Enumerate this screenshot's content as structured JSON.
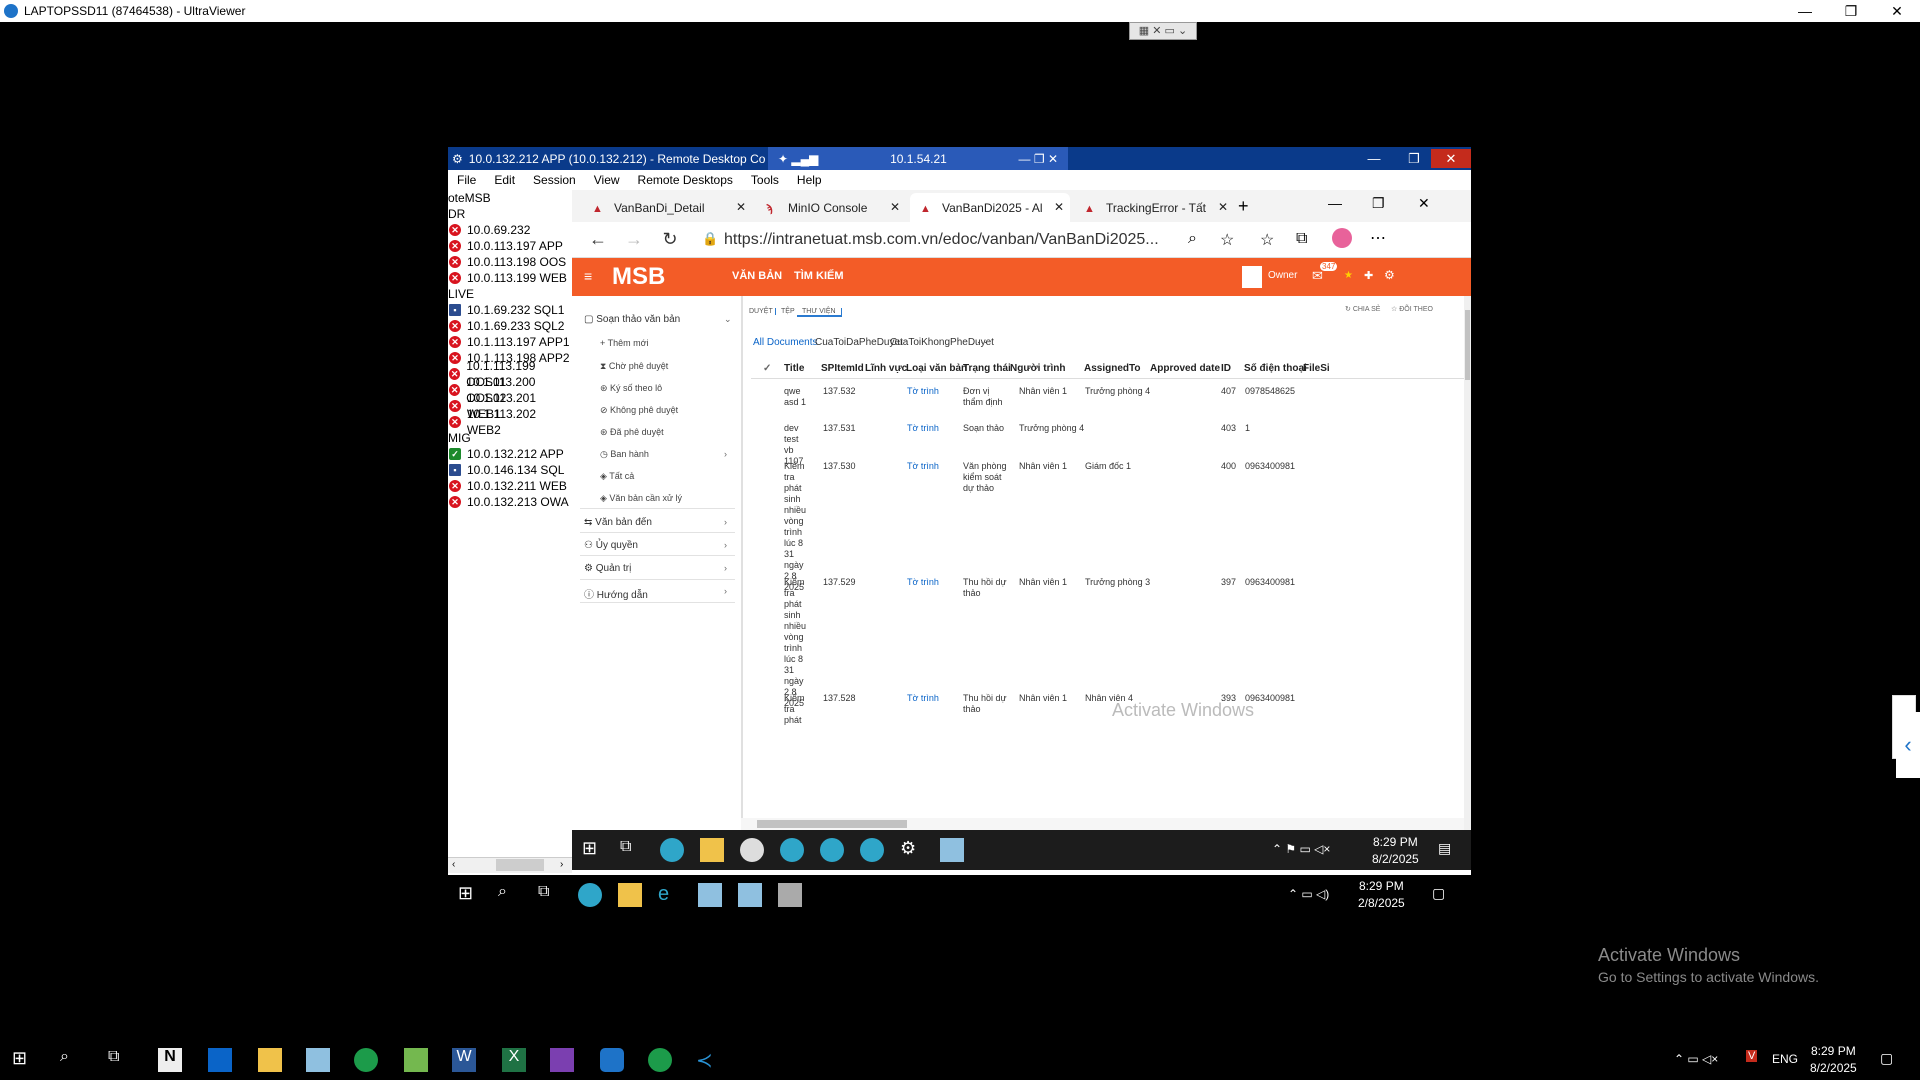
{
  "uv_title": "LAPTOPSSD11 (87464538) - UltraViewer",
  "uv_controls": {
    "minimize": "—",
    "restore": "❐",
    "close": "✕"
  },
  "rdc": {
    "title": "10.0.132.212 APP (10.0.132.212) - Remote Desktop Co",
    "conn_ip": "10.1.54.21",
    "menu": [
      "File",
      "Edit",
      "Session",
      "View",
      "Remote Desktops",
      "Tools",
      "Help"
    ],
    "tree": [
      {
        "type": "group",
        "label": "oteMSB"
      },
      {
        "type": "group",
        "label": "DR"
      },
      {
        "type": "item",
        "status": "err",
        "label": "10.0.69.232"
      },
      {
        "type": "item",
        "status": "err",
        "label": "10.0.113.197 APP"
      },
      {
        "type": "item",
        "status": "err",
        "label": "10.0.113.198 OOS"
      },
      {
        "type": "item",
        "status": "err",
        "label": "10.0.113.199 WEB"
      },
      {
        "type": "group",
        "label": "LIVE"
      },
      {
        "type": "item",
        "status": "pc",
        "label": "10.1.69.232 SQL1"
      },
      {
        "type": "item",
        "status": "err",
        "label": "10.1.69.233 SQL2"
      },
      {
        "type": "item",
        "status": "err",
        "label": "10.1.113.197 APP1"
      },
      {
        "type": "item",
        "status": "err",
        "label": "10.1.113.198 APP2"
      },
      {
        "type": "item",
        "status": "err",
        "label": "10.1.113.199 OOS01"
      },
      {
        "type": "item",
        "status": "err",
        "label": "10.1.113.200 OOS02"
      },
      {
        "type": "item",
        "status": "err",
        "label": "10.1.113.201 WEB1"
      },
      {
        "type": "item",
        "status": "err",
        "label": "10.1.113.202 WEB2"
      },
      {
        "type": "group",
        "label": "MIG"
      },
      {
        "type": "item",
        "status": "ok",
        "label": "10.0.132.212 APP"
      },
      {
        "type": "item",
        "status": "pc",
        "label": "10.0.146.134 SQL"
      },
      {
        "type": "item",
        "status": "err",
        "label": "10.0.132.211 WEB"
      },
      {
        "type": "item",
        "status": "err",
        "label": "10.0.132.213 OWA"
      }
    ]
  },
  "browser": {
    "tabs": [
      {
        "label": "VanBanDi_Detail"
      },
      {
        "label": "MinIO Console"
      },
      {
        "label": "VanBanDi2025 - Al"
      },
      {
        "label": "TrackingError - Tất"
      }
    ],
    "url": "https://intranetuat.msb.com.vn/edoc/vanban/VanBanDi2025..."
  },
  "msb": {
    "logo": "MSB",
    "nav": [
      "VĂN BẢN",
      "TÌM KIẾM"
    ],
    "owner": "Owner",
    "badge": "347",
    "left_sections": [
      {
        "label": "Soạn thảo văn bản"
      },
      {
        "label": "Văn bản đến"
      },
      {
        "label": "Ủy quyền"
      },
      {
        "label": "Quản trị"
      },
      {
        "label": "Hướng dẫn"
      }
    ],
    "left_subitems": [
      "Thêm mới",
      "Chờ phê duyệt",
      "Ký số theo lô",
      "Không phê duyệt",
      "Đã phê duyệt",
      "Ban hành",
      "Tất cả",
      "Văn bản cần xử lý"
    ],
    "pivots": [
      "DUYỆT",
      "TỆP",
      "THƯ VIỆN"
    ],
    "share": "CHIA SẺ",
    "follow": "ĐÕI THEO",
    "views": [
      "All Documents",
      "CuaToiDaPheDuyet",
      "CuaToiKhongPheDuyet",
      "···"
    ],
    "columns": [
      "✓",
      "Title",
      "SPItemId",
      "Lĩnh vực",
      "Loại văn bản",
      "Trạng thái",
      "Người trình",
      "AssignedTo",
      "Approved date",
      "ID",
      "Số điện thoại",
      "FileSi"
    ],
    "rows": [
      {
        "title": "qwe asd 1",
        "spid": "137.532",
        "loai": "Tờ trình",
        "trangthai": "Đơn vị thẩm định",
        "nguoitrinh": "Nhân viên 1",
        "assigned": "Trưởng phòng 4",
        "id": "407",
        "sdt": "0978548625"
      },
      {
        "title": "dev test vb 1107",
        "spid": "137.531",
        "loai": "Tờ trình",
        "trangthai": "Soạn thảo",
        "nguoitrinh": "Trưởng phòng 4",
        "assigned": "",
        "id": "403",
        "sdt": "1"
      },
      {
        "title": "Kiểm tra phát sinh nhiều vòng trình lúc 8 31 ngày 2 8 2025",
        "spid": "137.530",
        "loai": "Tờ trình",
        "trangthai": "Văn phòng kiểm soát dự thảo",
        "nguoitrinh": "Nhân viên 1",
        "assigned": "Giám đốc 1",
        "id": "400",
        "sdt": "0963400981"
      },
      {
        "title": "Kiểm tra phát sinh nhiều vòng trình lúc 8 31 ngày 2 8 2025",
        "spid": "137.529",
        "loai": "Tờ trình",
        "trangthai": "Thu hồi dự thảo",
        "nguoitrinh": "Nhân viên 1",
        "assigned": "Trưởng phòng 3",
        "id": "397",
        "sdt": "0963400981"
      },
      {
        "title": "Kiểm tra phát",
        "spid": "137.528",
        "loai": "Tờ trình",
        "trangthai": "Thu hồi dự thảo",
        "nguoitrinh": "Nhân viên 1",
        "assigned": "Nhân viên 4",
        "id": "393",
        "sdt": "0963400981"
      }
    ]
  },
  "inner_clock": {
    "time": "8:29 PM",
    "date": "8/2/2025"
  },
  "mid_clock": {
    "time": "8:29 PM",
    "date": "2/8/2025"
  },
  "bottom_clock": {
    "time": "8:29 PM",
    "date": "8/2/2025",
    "lang": "ENG"
  },
  "activate": {
    "line1": "Activate Windows",
    "line2": "Go to Settings to activate Windows."
  },
  "activate_inner": "Activate Windows",
  "colors": {
    "msb_orange": "#f35c27",
    "rdc_blue": "#0a3a8a",
    "error_red": "#d8131e",
    "link": "#0a64c8"
  }
}
